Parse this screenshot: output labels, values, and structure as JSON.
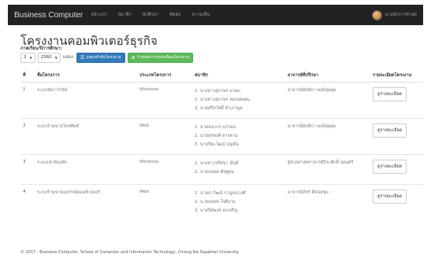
{
  "navbar": {
    "brand": "Business Computer",
    "items": [
      "หน้าแรก",
      "สมาชิก",
      "นักศึกษา",
      "ติดต่อ",
      "ความเห็น"
    ],
    "user": "นายนักการค้าสุด"
  },
  "page": {
    "title": "โครงงานคอมพิวเตอร์ธุรกิจ",
    "sub_label": "ภาคเรียน/ปีการศึกษา:"
  },
  "filters": {
    "term": "2",
    "year": "2560",
    "text": "แสดง",
    "btn_list_label": "แสดงหัวข้อโครงงาน",
    "btn_register_label": "กำหนดการลงทะเบียนโครงงาน"
  },
  "table": {
    "headers": [
      "ที่",
      "ชื่อโครงการ",
      "ประเภทโครงการ",
      "สมาชิก",
      "อาจารย์ที่ปรึกษา",
      "รายละเอียดโครงงาน"
    ],
    "rows": [
      {
        "no": "1",
        "name": "ระบบจัดการวิจัย",
        "type": "Windows",
        "members": [
          "1. นางสาวสุภาพร ยาดม",
          "2. นางสาวสุภาพร ทองนพคุณ",
          "3. นายศรีสวัสดิ์ สำเภาพูล"
        ],
        "advisor": "อาจารย์มัลลิกา พงษ์ลุ่มผุด",
        "detail": "ดูรายละเอียด"
      },
      {
        "no": "2",
        "name": "ระบบร้านขายโทรศัพท์",
        "type": "Web",
        "members": [
          "1. นายธนากร แก้วผล",
          "2. นายสุรพงศ์ สารคาม",
          "3. นายปิยะวัฒน์ บุญมั่น"
        ],
        "advisor": "อาจารย์มัลลิกา พงษ์ลุ่มผุด",
        "detail": "ดูรายละเอียด"
      },
      {
        "no": "3",
        "name": "ระบบเช่าห้องพัก",
        "type": "Windows",
        "members": [
          "1. นางสาวปริศนา มั่นมี",
          "2. นายธนพล ดิษฐคม"
        ],
        "advisor": "ผู้ช่วยศาสตราจารย์ธีระศักดิ์ จอมศรี",
        "detail": "ดูรายละเอียด"
      },
      {
        "no": "4",
        "name": "ระบบร้านขายอุปกรณ์คอมพิวเตอร์",
        "type": "Web",
        "members": [
          "1. นายธาวัฒน์ กาญจนวงศ์",
          "2. นายธนพล ใจดีงาม",
          "3. นายปิยพงษ์ คงเจริญ"
        ],
        "advisor": "อาจารย์ภัทร์ ศิลปสุขุม",
        "detail": "ดูรายละเอียด"
      }
    ]
  },
  "footer": "© 2017 - Business Computer, School of Computer and Information Technology, Chiang Rai Rajabhat University",
  "colors": {
    "navbar_bg": "#222222",
    "primary": "#337ab7",
    "success": "#5cb85c"
  },
  "icons": {
    "list_button": "list-icon",
    "register_button": "plus-circle-icon"
  }
}
